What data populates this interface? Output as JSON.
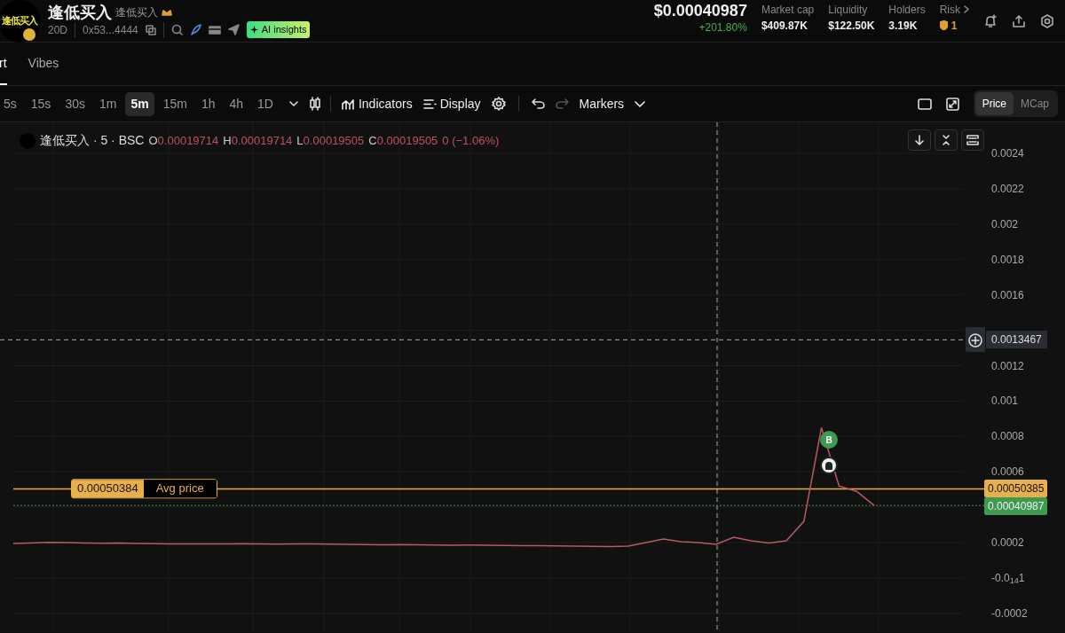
{
  "header": {
    "logo_text": "逢低买入",
    "name": "逢低买入",
    "subname": "逢低买入",
    "age": "20D",
    "address": "0x53...4444",
    "ai_badge": "AI insights",
    "price": "$0.00040987",
    "change": "+201.80%",
    "stats": [
      {
        "label": "Market cap",
        "value": "$409.87K"
      },
      {
        "label": "Liquidity",
        "value": "$122.50K"
      },
      {
        "label": "Holders",
        "value": "3.19K"
      }
    ],
    "risk": {
      "label": "Risk",
      "value": "1"
    }
  },
  "tabs": [
    {
      "label": "rt",
      "selected": true
    },
    {
      "label": "Vibes",
      "selected": false
    }
  ],
  "intervals": [
    {
      "label": "5s",
      "selected": false
    },
    {
      "label": "15s",
      "selected": false
    },
    {
      "label": "30s",
      "selected": false
    },
    {
      "label": "1m",
      "selected": false
    },
    {
      "label": "5m",
      "selected": true
    },
    {
      "label": "15m",
      "selected": false
    },
    {
      "label": "1h",
      "selected": false
    },
    {
      "label": "4h",
      "selected": false
    },
    {
      "label": "1D",
      "selected": false
    }
  ],
  "toolbar": {
    "indicators": "Indicators",
    "display": "Display",
    "markers": "Markers",
    "redo_disabled": true
  },
  "price_toggle": [
    {
      "label": "Price",
      "selected": true
    },
    {
      "label": "MCap",
      "selected": false
    }
  ],
  "legend": {
    "symbol": "逢低买入 · 5 · BSC",
    "values": [
      {
        "key": "O",
        "value": "0.00019714"
      },
      {
        "key": "H",
        "value": "0.00019714"
      },
      {
        "key": "L",
        "value": "0.00019505"
      },
      {
        "key": "C",
        "value": "0.00019505"
      }
    ],
    "change": "0 (−1.06%)"
  },
  "chart": {
    "crosshair_price": "0.0013467",
    "avg_price": {
      "value": "0.00050384",
      "label": "Avg price",
      "axis": "0.00050385"
    },
    "last_price": "0.00040987",
    "trade_marker": "B",
    "chart_data": {
      "type": "line",
      "grid": true,
      "ylim": [
        -0.000306,
        0.002576
      ],
      "ref_lines": [
        {
          "axis": "y",
          "value": 0.0013467,
          "color": "#aaaaaa"
        },
        {
          "axis": "y",
          "value": 0.00050384,
          "color": "#e8b04a"
        },
        {
          "axis": "y",
          "value": 0.00040987,
          "color": "#3d9a50"
        }
      ],
      "series": [
        {
          "color": "#b85a63",
          "values": [
            0.000195,
            0.000198,
            0.000201,
            0.0002,
            0.000198,
            0.000196,
            0.000197,
            0.000195,
            0.000194,
            0.000193,
            0.000193,
            0.000192,
            0.000193,
            0.000194,
            0.000192,
            0.000191,
            0.000192,
            0.000193,
            0.000191,
            0.00019,
            0.000189,
            0.000188,
            0.000189,
            0.000187,
            0.000186,
            0.000185,
            0.000186,
            0.000185,
            0.000184,
            0.000183,
            0.000182,
            0.000181,
            0.00018,
            0.000179,
            0.000178,
            0.00018,
            0.0002,
            0.00022,
            0.000205,
            0.0002,
            0.00019,
            0.00023,
            0.00021,
            0.000198,
            0.00021,
            0.00032,
            0.00085,
            0.00052,
            0.00049,
            0.00041
          ]
        }
      ],
      "yticks": [
        0.0024,
        0.0022,
        0.002,
        0.0018,
        0.0016,
        0.0012,
        0.001,
        0.0008,
        0.0006,
        0.0002,
        {
          "value": 0,
          "label": "-0.0$_{14}$1"
        },
        -0.0002
      ]
    }
  }
}
